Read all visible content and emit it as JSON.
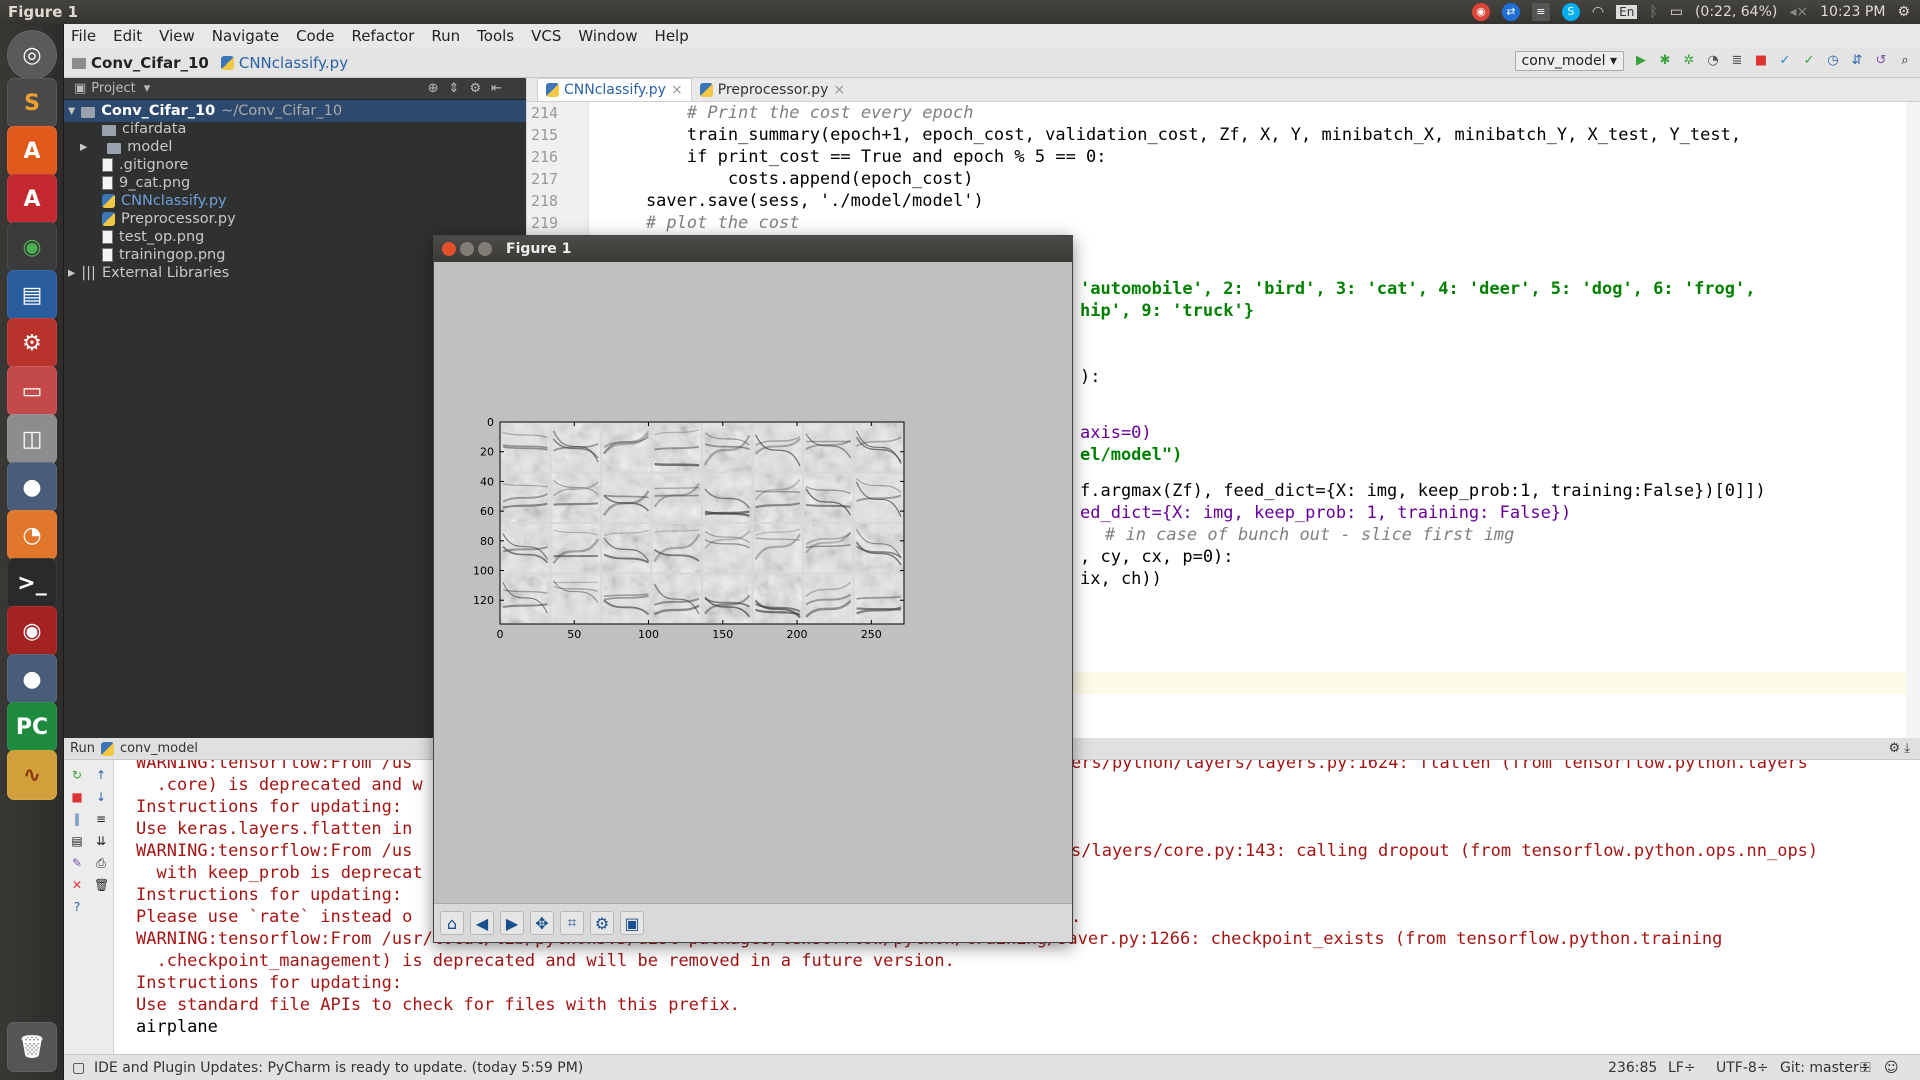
{
  "window_title": "Figure 1",
  "system": {
    "battery": "(0:22, 64%)",
    "time": "10:23 PM",
    "keyboard": "En"
  },
  "launcher": [
    "ubuntu-dash",
    "sublime-text",
    "software-center",
    "rstudio",
    "chrome",
    "writer",
    "settings",
    "files",
    "disk",
    "scope",
    "blender",
    "terminal",
    "spotify",
    "scope2",
    "pycharm",
    "oscilloscope",
    "trash"
  ],
  "menu": [
    "File",
    "Edit",
    "View",
    "Navigate",
    "Code",
    "Refactor",
    "Run",
    "Tools",
    "VCS",
    "Window",
    "Help"
  ],
  "breadcrumb": {
    "project": "Conv_Cifar_10",
    "file": "CNNclassify.py"
  },
  "run_config": "conv_model",
  "project_panel": {
    "header": "Project",
    "items": [
      {
        "label": "Conv_Cifar_10",
        "suffix": "~/Conv_Cifar_10",
        "type": "folder",
        "level": 0,
        "expanded": true
      },
      {
        "label": "cifardata",
        "type": "folder",
        "level": 1
      },
      {
        "label": "model",
        "type": "folder",
        "level": 1,
        "collapsed": true
      },
      {
        "label": ".gitignore",
        "type": "file",
        "level": 1
      },
      {
        "label": "9_cat.png",
        "type": "file",
        "level": 1
      },
      {
        "label": "CNNclassify.py",
        "type": "py",
        "level": 1
      },
      {
        "label": "Preprocessor.py",
        "type": "py",
        "level": 1
      },
      {
        "label": "test_op.png",
        "type": "file",
        "level": 1
      },
      {
        "label": "trainingop.png",
        "type": "file",
        "level": 1
      },
      {
        "label": "External Libraries",
        "type": "lib",
        "level": 0
      }
    ]
  },
  "editor": {
    "tabs": [
      {
        "label": "CNNclassify.py",
        "active": true
      },
      {
        "label": "Preprocessor.py",
        "active": false
      }
    ],
    "line_numbers": [
      "214",
      "215",
      "216",
      "217",
      "218",
      "219"
    ],
    "code_lines": [
      "        # Print the cost every epoch",
      "        train_summary(epoch+1, epoch_cost, validation_cost, Zf, X, Y, minibatch_X, minibatch_Y, X_test, Y_test,",
      "        if print_cost == True and epoch % 5 == 0:",
      "            costs.append(epoch_cost)",
      "    saver.save(sess, './model/model')",
      "    # plot the cost"
    ],
    "partial_lines": [
      "'automobile', 2: 'bird', 3: 'cat', 4: 'deer', 5: 'dog', 6: 'frog',",
      "hip', 9: 'truck'}",
      "):",
      "axis=0)",
      "el/model\")",
      "f.argmax(Zf), feed_dict={X: img, keep_prob:1, training:False})[0]])",
      "ed_dict={X: img, keep_prob: 1, training: False})",
      "# in case of bunch out - slice first img",
      ", cy, cx, p=0):",
      "ix, ch))"
    ]
  },
  "run_panel": {
    "title": "Run",
    "config": "conv_model",
    "lines": [
      "WARNING:tensorflow:From /us",
      "  .core) is deprecated and w",
      "Instructions for updating:",
      "Use keras.layers.flatten in",
      "WARNING:tensorflow:From /us",
      "  with keep_prob is deprecat",
      "Instructions for updating:",
      "Please use `rate` instead o",
      "WARNING:tensorflow:From /usr/local/lib/python3.5/dist-packages/tensorflow/python/training/saver.py:1266: checkpoint_exists (from tensorflow.python.training",
      "  .checkpoint_management) is deprecated and will be removed in a future version.",
      "Instructions for updating:",
      "Use standard file APIs to check for files with this prefix.",
      "airplane"
    ],
    "right_fragments": [
      "ers/python/layers/layers.py:1624: flatten (from tensorflow.python.layers",
      "s/layers/core.py:143: calling dropout (from tensorflow.python.ops.nn_ops)",
      "."
    ]
  },
  "status_bar": {
    "message": "IDE and Plugin Updates: PyCharm is ready to update. (today 5:59 PM)",
    "position": "236:85",
    "line_sep": "LF÷",
    "encoding": "UTF-8÷",
    "git": "Git: master÷"
  },
  "figure": {
    "title": "Figure 1",
    "toolbar": [
      "home-icon",
      "back-icon",
      "forward-icon",
      "pan-icon",
      "zoom-icon",
      "configure-icon",
      "save-icon"
    ]
  },
  "chart_data": {
    "type": "heatmap",
    "title": "",
    "grid_rows": 4,
    "grid_cols": 8,
    "x_ticks": [
      "0",
      "50",
      "100",
      "150",
      "200",
      "250"
    ],
    "y_ticks": [
      "0",
      "20",
      "40",
      "60",
      "80",
      "100",
      "120"
    ],
    "xlim": [
      0,
      272
    ],
    "ylim": [
      0,
      136
    ],
    "colormap": "gray"
  }
}
